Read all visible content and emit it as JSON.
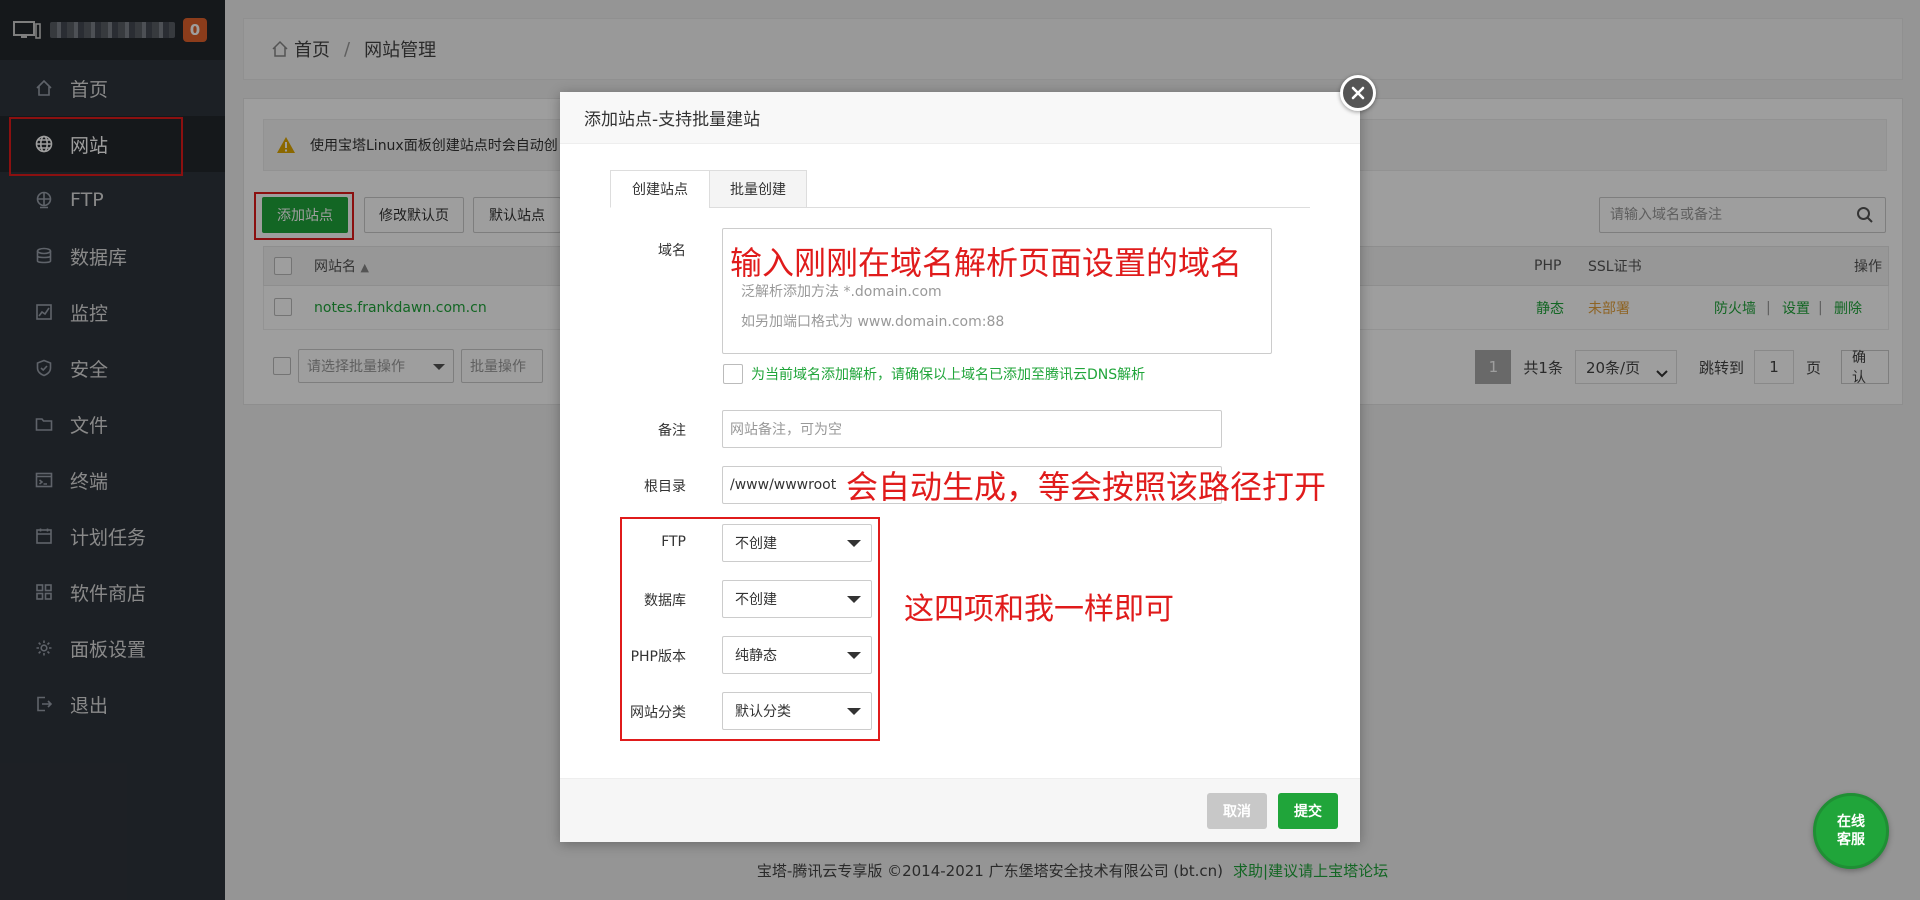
{
  "sidebar": {
    "badge": "0",
    "items": [
      {
        "label": "首页",
        "icon": "home-icon"
      },
      {
        "label": "网站",
        "icon": "globe-icon"
      },
      {
        "label": "FTP",
        "icon": "ftp-icon"
      },
      {
        "label": "数据库",
        "icon": "database-icon"
      },
      {
        "label": "监控",
        "icon": "monitor-chart-icon"
      },
      {
        "label": "安全",
        "icon": "shield-icon"
      },
      {
        "label": "文件",
        "icon": "folder-icon"
      },
      {
        "label": "终端",
        "icon": "terminal-icon"
      },
      {
        "label": "计划任务",
        "icon": "calendar-icon"
      },
      {
        "label": "软件商店",
        "icon": "grid-icon"
      },
      {
        "label": "面板设置",
        "icon": "gear-icon"
      },
      {
        "label": "退出",
        "icon": "logout-icon"
      }
    ]
  },
  "breadcrumb": {
    "home": "首页",
    "sep": "/",
    "current": "网站管理"
  },
  "notice": {
    "text": "使用宝塔Linux面板创建站点时会自动创"
  },
  "toolbar": {
    "add_site": "添加站点",
    "modify_default_page": "修改默认页",
    "default_site": "默认站点",
    "search_placeholder": "请输入域名或备注"
  },
  "table": {
    "headers": {
      "name": "网站名",
      "php": "PHP",
      "ssl": "SSL证书",
      "action": "操作"
    },
    "rows": [
      {
        "name": "notes.frankdawn.com.cn",
        "php": "静态",
        "ssl": "未部署",
        "firewall": "防火墙",
        "settings": "设置",
        "delete": "删除"
      }
    ]
  },
  "bottom": {
    "batch_select_placeholder": "请选择批量操作",
    "batch_button": "批量操作",
    "page_current": "1",
    "total": "共1条",
    "per_page": "20条/页",
    "jump_label": "跳转到",
    "jump_value": "1",
    "page_unit": "页",
    "confirm": "确认"
  },
  "footer": {
    "copyright": "宝塔-腾讯云专享版 ©2014-2021 广东堡塔安全技术有限公司 (bt.cn)",
    "link": "求助|建议请上宝塔论坛"
  },
  "modal": {
    "title": "添加站点-支持批量建站",
    "tabs": [
      "创建站点",
      "批量创建"
    ],
    "labels": {
      "domain": "域名",
      "remark": "备注",
      "root": "根目录",
      "ftp": "FTP",
      "db": "数据库",
      "php": "PHP版本",
      "category": "网站分类"
    },
    "domain_hints": [
      "泛解析添加方法 *.domain.com",
      "如另加端口格式为 www.domain.com:88"
    ],
    "dns_checkbox": "为当前域名添加解析，请确保以上域名已添加至腾讯云DNS解析",
    "remark_placeholder": "网站备注，可为空",
    "root_value": "/www/wwwroot",
    "ftp_value": "不创建",
    "db_value": "不创建",
    "php_value": "纯静态",
    "category_value": "默认分类",
    "cancel": "取消",
    "submit": "提交"
  },
  "annotations": {
    "domain": "输入刚刚在域名解析页面设置的域名",
    "root": "会自动生成，等会按照该路径打开",
    "four": "这四项和我一样即可"
  },
  "chat": {
    "line1": "在线",
    "line2": "客服"
  },
  "colors": {
    "accent": "#20a53a",
    "annotation": "#e01b1b",
    "sidebar": "#2e343c",
    "badge": "#e0622d",
    "warning": "#e0a800"
  }
}
